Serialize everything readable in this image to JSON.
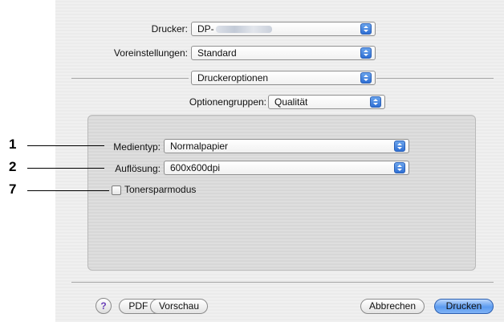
{
  "printer": {
    "label": "Drucker:",
    "value": "DP-"
  },
  "presets": {
    "label": "Voreinstellungen:",
    "value": "Standard"
  },
  "pane_menu": {
    "value": "Druckeroptionen"
  },
  "option_groups": {
    "label": "Optionengruppen:",
    "value": "Qualität"
  },
  "settings": {
    "media_type": {
      "label": "Medientyp:",
      "value": "Normalpapier"
    },
    "resolution": {
      "label": "Auflösung:",
      "value": "600x600dpi"
    },
    "toner_save": {
      "label": "Tonersparmodus",
      "checked": false
    }
  },
  "callouts": [
    "1",
    "2",
    "7"
  ],
  "footer": {
    "help_label": "?",
    "pdf_label": "PDF ▾",
    "preview_label": "Vorschau",
    "cancel_label": "Abbrechen",
    "print_label": "Drucken"
  },
  "colors": {
    "accent": "#5b9bf0",
    "help_glyph": "#6a3fb8"
  }
}
